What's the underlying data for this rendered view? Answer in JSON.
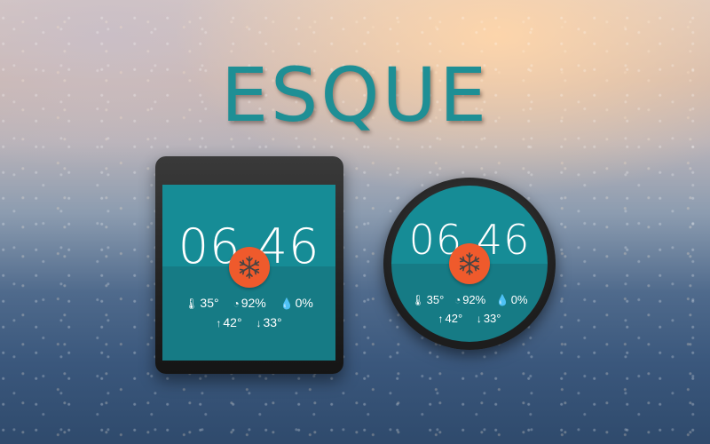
{
  "app": {
    "title": "ESQUE"
  },
  "watch_face": {
    "time": "06 46",
    "temperature": "35°",
    "humidity": "92%",
    "precipitation": "0%",
    "high": "42°",
    "low": "33°",
    "condition_icon": "snowflake-icon"
  },
  "colors": {
    "title": "#1e8f95",
    "face_top": "#168c96",
    "face_bottom": "#167b85",
    "badge": "#ef5a2c"
  },
  "icons": {
    "thermometer": "thermometer-icon",
    "humidity": "humidity-gauge-icon",
    "drop": "water-drop-icon",
    "up": "arrow-up-icon",
    "down": "arrow-down-icon"
  }
}
